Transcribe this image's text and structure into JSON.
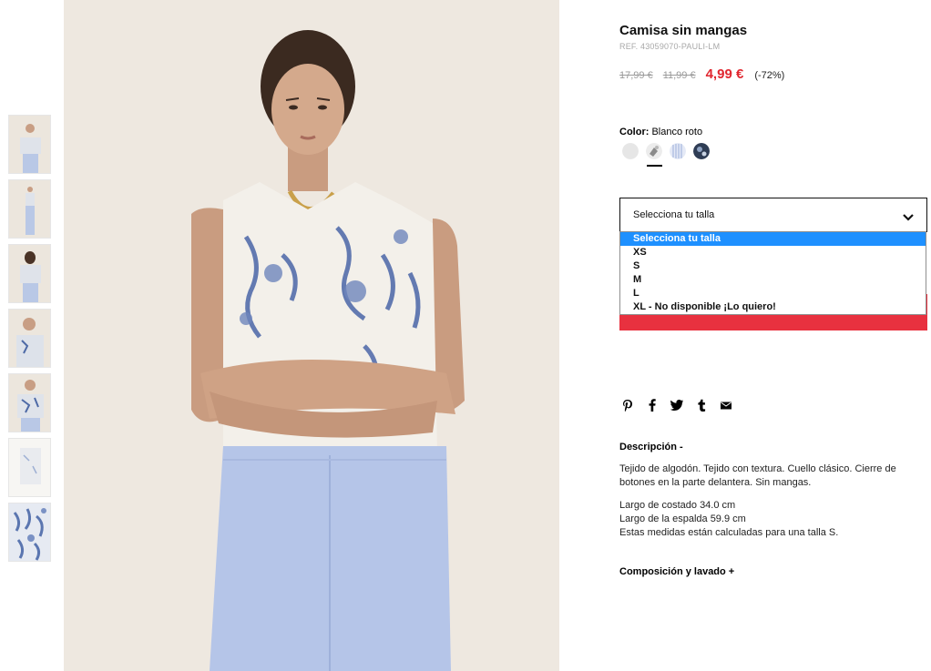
{
  "product": {
    "title": "Camisa sin mangas",
    "ref": "REF. 43059070-PAULI-LM",
    "old_price_1": "17,99 €",
    "old_price_2": "11,99 €",
    "sale_price": "4,99 €",
    "discount": "(-72%)"
  },
  "color": {
    "label": "Color:",
    "value": "Blanco roto",
    "swatches": [
      "light-grey",
      "floral-print",
      "blue-stripe",
      "navy-floral"
    ],
    "selected_index": 1
  },
  "size": {
    "placeholder": "Selecciona tu talla",
    "options": [
      "Selecciona tu talla",
      "XS",
      "S",
      "M",
      "L",
      "XL - No disponible ¡Lo quiero!"
    ],
    "selected_option": "Selecciona tu talla"
  },
  "share": {
    "icons": [
      "pinterest-icon",
      "facebook-icon",
      "twitter-icon",
      "tumblr-icon",
      "email-icon"
    ]
  },
  "description": {
    "heading": "Descripción -",
    "text": "Tejido de algodón. Tejido con textura. Cuello clásico. Cierre de botones en la parte delantera. Sin mangas.",
    "measures": [
      "Largo de costado 34.0 cm",
      "Largo de la espalda 59.9 cm",
      "Estas medidas están calculadas para una talla S."
    ]
  },
  "composition": {
    "heading": "Composición y lavado +"
  },
  "colors": {
    "sale_red": "#e0262f",
    "add_bar_red": "#e8313f",
    "dropdown_highlight": "#1e90ff"
  }
}
